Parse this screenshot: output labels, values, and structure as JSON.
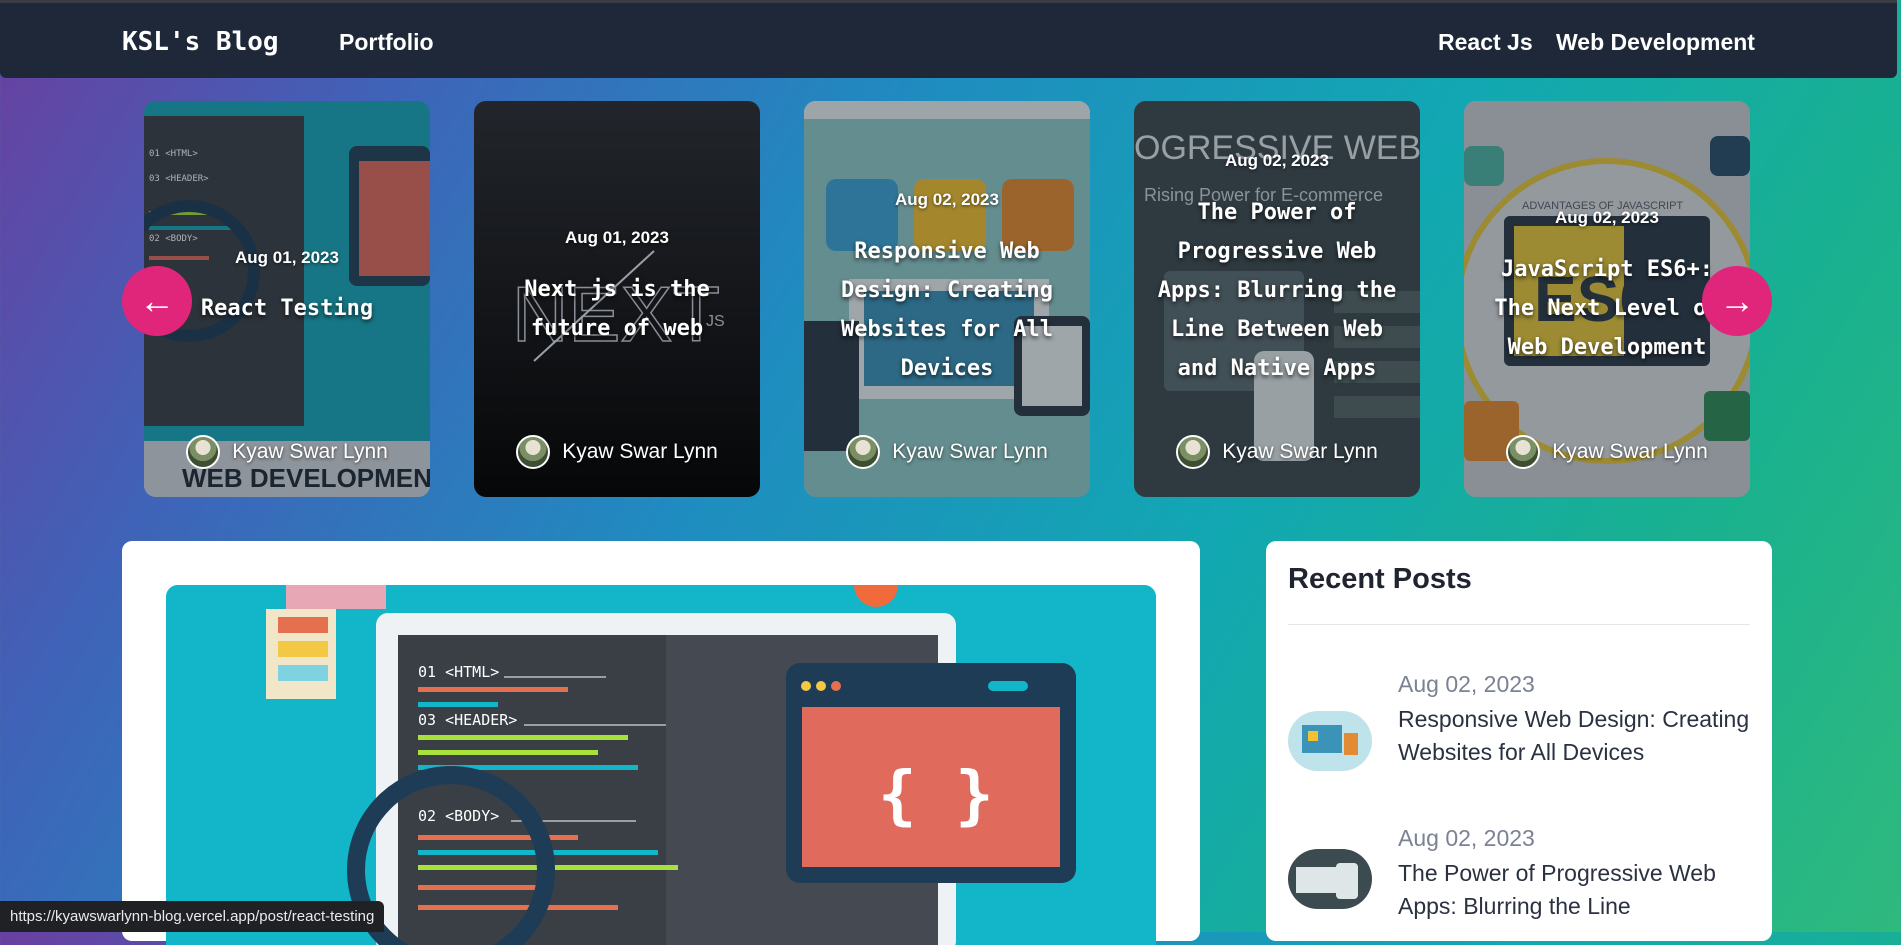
{
  "nav": {
    "brand": "KSL's Blog",
    "portfolio": "Portfolio",
    "react": "React Js",
    "webdev": "Web Development"
  },
  "carousel": {
    "cards": [
      {
        "date": "Aug 01, 2023",
        "title": "React Testing",
        "author": "Kyaw Swar Lynn"
      },
      {
        "date": "Aug 01, 2023",
        "title": "Next js is the future of web",
        "author": "Kyaw Swar Lynn"
      },
      {
        "date": "Aug 02, 2023",
        "title": "Responsive Web Design: Creating Websites for All Devices",
        "author": "Kyaw Swar Lynn"
      },
      {
        "date": "Aug 02, 2023",
        "title": "The Power of Progressive Web Apps: Blurring the Line Between Web and Native Apps",
        "author": "Kyaw Swar Lynn"
      },
      {
        "date": "Aug 02, 2023",
        "title": "JavaScript ES6+: The Next Level of Web Development",
        "author": "Kyaw Swar Lynn"
      }
    ]
  },
  "recent": {
    "title": "Recent Posts",
    "items": [
      {
        "date": "Aug 02, 2023",
        "title": "Responsive Web Design: Creating Websites for All Devices"
      },
      {
        "date": "Aug 02, 2023",
        "title": "The Power of Progressive Web Apps: Blurring the Line"
      }
    ]
  },
  "hero_art": {
    "code_lines": [
      "01 <HTML>",
      "03 <HEADER>",
      "02 <BODY>"
    ],
    "braces": "{ }"
  },
  "card_art": {
    "card1_code": [
      "01 <HTML>",
      "03 <HEADER>",
      "02 <BODY>"
    ],
    "card1_banner": "WEB DEVELOPMENT",
    "card2_logo": "NEXT",
    "card2_logo_sub": "JS",
    "card4_banner": "OGRESSIVE WEB A",
    "card4_sub": "Rising Power for E-commerce",
    "card5_header": "ADVANTAGES OF JAVASCRIPT",
    "card5_logo": "ES6"
  },
  "status": {
    "url": "https://kyawswarlynn-blog.vercel.app/post/react-testing"
  }
}
